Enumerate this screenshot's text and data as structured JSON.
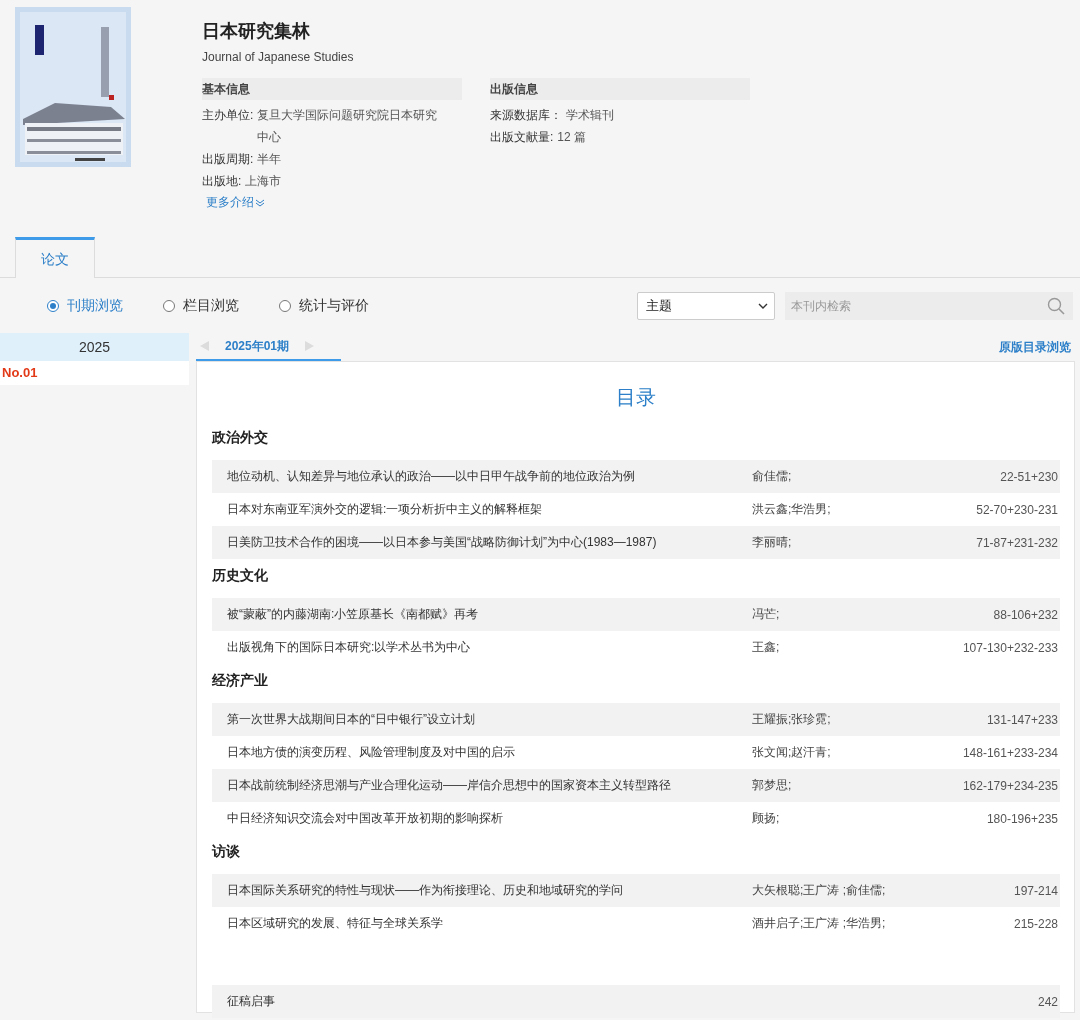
{
  "journal": {
    "title": "日本研究集林",
    "subtitle": "Journal of Japanese Studies",
    "info_groups": [
      {
        "heading": "基本信息",
        "items": [
          {
            "label": "主办单位:",
            "value": "复旦大学国际问题研究院日本研究中心"
          },
          {
            "label": "出版周期:",
            "value": "半年"
          },
          {
            "label": "出版地:",
            "value": "上海市"
          }
        ]
      },
      {
        "heading": "出版信息",
        "items": [
          {
            "label": "来源数据库：",
            "value": "学术辑刊"
          },
          {
            "label": "出版文献量:",
            "value": "12 篇"
          }
        ]
      }
    ],
    "more_link": "更多介绍"
  },
  "tabs": [
    {
      "label": "论文",
      "selected": true
    }
  ],
  "view_options": [
    {
      "label": "刊期浏览",
      "selected": true
    },
    {
      "label": "栏目浏览",
      "selected": false
    },
    {
      "label": "统计与评价",
      "selected": false
    }
  ],
  "search": {
    "field": "主题",
    "placeholder": "本刊内检索"
  },
  "years": [
    {
      "year": "2025",
      "issues": [
        {
          "label": "No.01",
          "selected": true
        }
      ]
    }
  ],
  "issue_nav": {
    "current": "2025年01期",
    "original_link": "原版目录浏览"
  },
  "toc": {
    "title": "目录",
    "sections": [
      {
        "heading": "政治外交",
        "articles": [
          {
            "title": "地位动机、认知差异与地位承认的政治——以中日甲午战争前的地位政治为例",
            "authors": "俞佳儒;",
            "pages": "22-51+230"
          },
          {
            "title": "日本对东南亚军演外交的逻辑:一项分析折中主义的解释框架",
            "authors": "洪云鑫;华浩男;",
            "pages": "52-70+230-231"
          },
          {
            "title": "日美防卫技术合作的困境——以日本参与美国“战略防御计划”为中心(1983—1987)",
            "authors": "李丽晴;",
            "pages": "71-87+231-232"
          }
        ]
      },
      {
        "heading": "历史文化",
        "articles": [
          {
            "title": "被“蒙蔽”的内藤湖南:小笠原基长《南都赋》再考",
            "authors": "冯芒;",
            "pages": "88-106+232"
          },
          {
            "title": "出版视角下的国际日本研究:以学术丛书为中心",
            "authors": "王鑫;",
            "pages": "107-130+232-233"
          }
        ]
      },
      {
        "heading": "经济产业",
        "articles": [
          {
            "title": "第一次世界大战期间日本的“日中银行”设立计划",
            "authors": "王耀振;张珍霓;",
            "pages": "131-147+233"
          },
          {
            "title": "日本地方债的演变历程、风险管理制度及对中国的启示",
            "authors": "张文闻;赵汗青;",
            "pages": "148-161+233-234"
          },
          {
            "title": "日本战前统制经济思潮与产业合理化运动——岸信介思想中的国家资本主义转型路径",
            "authors": "郭梦思;",
            "pages": "162-179+234-235"
          },
          {
            "title": "中日经济知识交流会对中国改革开放初期的影响探析",
            "authors": "顾扬;",
            "pages": "180-196+235"
          }
        ]
      },
      {
        "heading": "访谈",
        "articles": [
          {
            "title": "日本国际关系研究的特性与现状——作为衔接理论、历史和地域研究的学问",
            "authors": "大矢根聪;王广涛 ;俞佳儒;",
            "pages": "197-214"
          },
          {
            "title": "日本区域研究的发展、特征与全球关系学",
            "authors": "酒井启子;王广涛 ;华浩男;",
            "pages": "215-228"
          }
        ]
      }
    ],
    "notice": {
      "title": "征稿启事",
      "pages": "242"
    }
  }
}
